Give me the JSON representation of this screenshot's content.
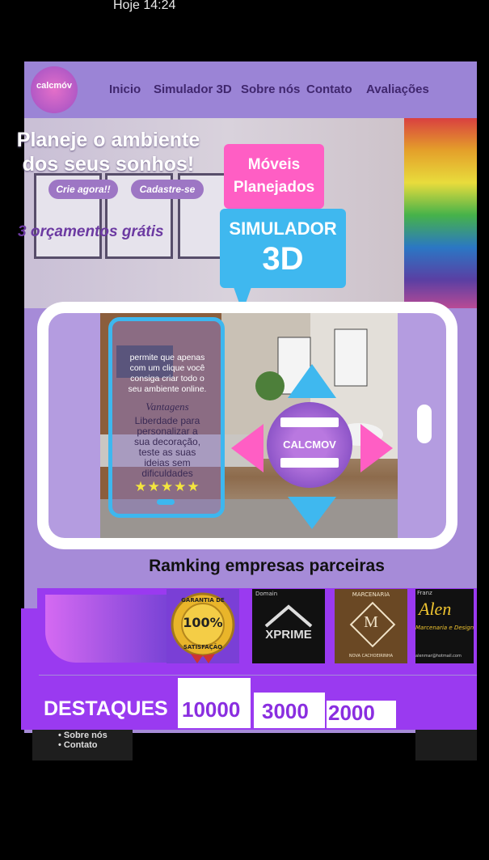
{
  "status": {
    "time": "Hoje 14:24"
  },
  "logo": {
    "text": "calcmóv"
  },
  "nav": [
    {
      "label": "Inicio"
    },
    {
      "label": "Simulador 3D"
    },
    {
      "label": "Sobre nós"
    },
    {
      "label": "Contato"
    },
    {
      "label": "Avaliações"
    }
  ],
  "hero": {
    "title_line1": "Planeje o ambiente",
    "title_line2": "dos seus sonhos!",
    "cta_create": "Crie agora!!",
    "cta_register": "Cadastre-se",
    "free_quotes": "3 orçamentos grátis"
  },
  "promo": {
    "bubble_line1": "Móveis",
    "bubble_line2": "Planejados",
    "simulator": "SIMULADOR",
    "simulator_3d": "3D"
  },
  "mini_phone": {
    "text_line1": "permite que apenas",
    "text_line2": "com um clique você",
    "text_line3": "consiga criar todo o",
    "text_line4": "seu ambiente online.",
    "advantages_title": "Vantagens",
    "adv_line1": "Liberdade para",
    "adv_line2": "personalizar a",
    "adv_line3": "sua decoração,",
    "adv_line4": "teste as suas",
    "adv_line5": "ideias sem",
    "adv_line6": "dificuldades",
    "stars": "★★★★★",
    "rating_stars": 5
  },
  "calc": {
    "label": "CALCMOV"
  },
  "ranking": {
    "title": "Ramking empresas  parceiras"
  },
  "partners": {
    "seal_line1": "GARANTIA DE",
    "seal_value": "100%",
    "seal_line2": "SATISFAÇÃO",
    "xprime_small": "Domain",
    "xprime": "XPRIME",
    "marcenaria_top": "MARCENARIA",
    "marcenaria_letter": "M",
    "marcenaria_bottom": "NOVA CACHOEIRINHA",
    "alen_small": "Franz",
    "alen": "Alen",
    "alen_sub": "Marcenaria e Design",
    "alen_email": "alenmar@hotmail.com"
  },
  "highlights": {
    "label": "DESTAQUES",
    "values": [
      "10000",
      "3000",
      "2000"
    ]
  },
  "footer": {
    "line1": "• Sobre nós",
    "line2": "• Contato"
  },
  "colors": {
    "accent_purple": "#9a3af0",
    "pink": "#ff5ec4",
    "blue": "#3fb8ef",
    "nav_bg": "#9b84d6"
  }
}
